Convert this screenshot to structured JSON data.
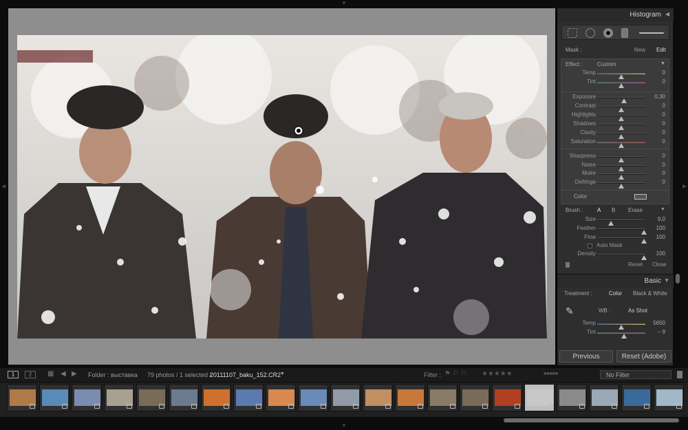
{
  "histogram": {
    "title": "Histogram"
  },
  "mask": {
    "label": "Mask :",
    "new": "New",
    "edit": "Edit"
  },
  "effect": {
    "label": "Effect :",
    "preset": "Custom"
  },
  "sliders_group1": [
    {
      "label": "Temp",
      "value": "0",
      "pos": 0.5
    },
    {
      "label": "Tint",
      "value": "0",
      "pos": 0.5
    }
  ],
  "sliders_group2": [
    {
      "label": "Exposure",
      "value": "0,30",
      "pos": 0.55
    },
    {
      "label": "Contrast",
      "value": "0",
      "pos": 0.5
    },
    {
      "label": "Highlights",
      "value": "0",
      "pos": 0.5
    },
    {
      "label": "Shadows",
      "value": "0",
      "pos": 0.5
    },
    {
      "label": "Clarity",
      "value": "0",
      "pos": 0.5
    },
    {
      "label": "Saturation",
      "value": "0",
      "pos": 0.5
    }
  ],
  "sliders_group3": [
    {
      "label": "Sharpness",
      "value": "0",
      "pos": 0.5
    },
    {
      "label": "Noise",
      "value": "0",
      "pos": 0.5
    },
    {
      "label": "Moire",
      "value": "0",
      "pos": 0.5
    },
    {
      "label": "Defringe",
      "value": "0",
      "pos": 0.5
    }
  ],
  "color": {
    "label": "Color"
  },
  "brush": {
    "label": "Brush :",
    "a": "A",
    "b": "B",
    "erase": "Erase",
    "size_label": "Size",
    "size_value": "9,0",
    "feather_label": "Feather",
    "feather_value": "100",
    "flow_label": "Flow",
    "flow_value": "100",
    "automask_label": "Auto Mask",
    "density_label": "Density",
    "density_value": "100"
  },
  "actions": {
    "reset": "Reset",
    "close": "Close"
  },
  "basic": {
    "title": "Basic",
    "treatment_label": "Treatment :",
    "color": "Color",
    "bw": "Black & White",
    "wb_label": "WB :",
    "wb_value": "As Shot",
    "temp_label": "Temp",
    "temp_value": "5650",
    "tint_label": "Tint",
    "tint_value": "– 9"
  },
  "buttons": {
    "previous": "Previous",
    "reset_adobe": "Reset (Adobe)"
  },
  "toolbar": {
    "view1": "1",
    "view2": "2",
    "folder": "Folder : выставка",
    "count": "79 photos / 1 selected /",
    "filename": "20111107_baku_152.CR2",
    "filter_label": "Filter :",
    "filter_value": "No Filter"
  },
  "filmstrip": [
    "#b07a48",
    "#5a8ab8",
    "#7a8cb0",
    "#a8a090",
    "#7a6a58",
    "#6a7a90",
    "#d07030",
    "#5a7ab0",
    "#d88850",
    "#6a8ab8",
    "#909aa8",
    "#c09060",
    "#c8783a",
    "#8a7a68",
    "#7a6a5a",
    "#b04020",
    "#c8c8c8",
    "#8a8a8a",
    "#9aa8b8",
    "#3a6a9a",
    "#a0b8c8"
  ]
}
